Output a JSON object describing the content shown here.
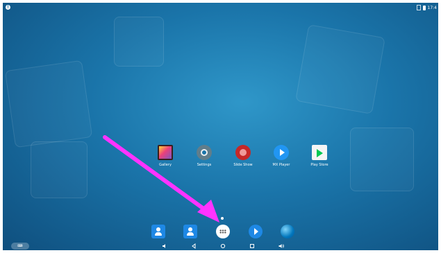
{
  "status_bar": {
    "time": "17:4"
  },
  "apps": [
    {
      "label": "Gallery",
      "icon": "gallery-icon"
    },
    {
      "label": "Settings",
      "icon": "settings-icon"
    },
    {
      "label": "Slide Show",
      "icon": "slideshow-icon"
    },
    {
      "label": "MX Player",
      "icon": "mx-player-icon"
    },
    {
      "label": "Play Store",
      "icon": "play-store-icon"
    }
  ],
  "dock": [
    {
      "icon": "contacts-icon"
    },
    {
      "icon": "contacts-icon"
    },
    {
      "icon": "app-launcher-icon"
    },
    {
      "icon": "play-icon"
    },
    {
      "icon": "browser-icon"
    }
  ],
  "navbar": {
    "buttons": [
      "volume-down-icon",
      "back-icon",
      "home-icon",
      "recents-icon",
      "volume-up-icon"
    ],
    "keyboard_label": "⌨"
  },
  "annotation": {
    "arrow_color": "#ff33ff"
  }
}
